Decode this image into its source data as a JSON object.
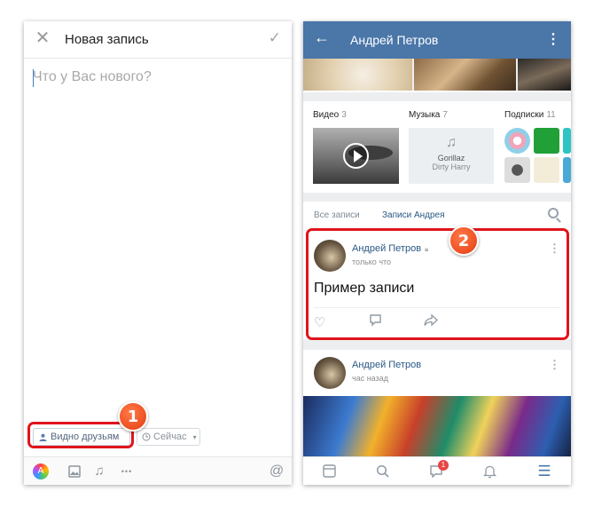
{
  "left": {
    "title": "Новая запись",
    "placeholder": "Что у Вас нового?",
    "visibility_label": "Видно друзьям",
    "time_label": "Сейчас",
    "badge": "1",
    "icons": [
      "close-icon",
      "check-icon",
      "user-icon",
      "clock-icon",
      "chevron-down-icon",
      "sticker-icon",
      "photo-icon",
      "music-icon",
      "more-icon",
      "mention-icon"
    ],
    "more_glyph": "•••",
    "mention_glyph": "@"
  },
  "right": {
    "title": "Андрей Петров",
    "media": {
      "video_label": "Видео",
      "video_count": "3",
      "music_label": "Музыка",
      "music_count": "7",
      "subs_label": "Подписки",
      "subs_count": "11",
      "music_artist": "Gorillaz",
      "music_track": "Dirty Harry"
    },
    "tabs": {
      "all": "Все записи",
      "own": "Записи Андрея"
    },
    "badge": "2",
    "posts": [
      {
        "author": "Андрей Петров",
        "time": "только что",
        "text": "Пример записи"
      },
      {
        "author": "Андрей Петров",
        "time": "час назад"
      }
    ],
    "nav_badge": "1",
    "colors": {
      "header": "#4a76a8",
      "link": "#2a5885",
      "highlight": "#e0141b"
    }
  }
}
